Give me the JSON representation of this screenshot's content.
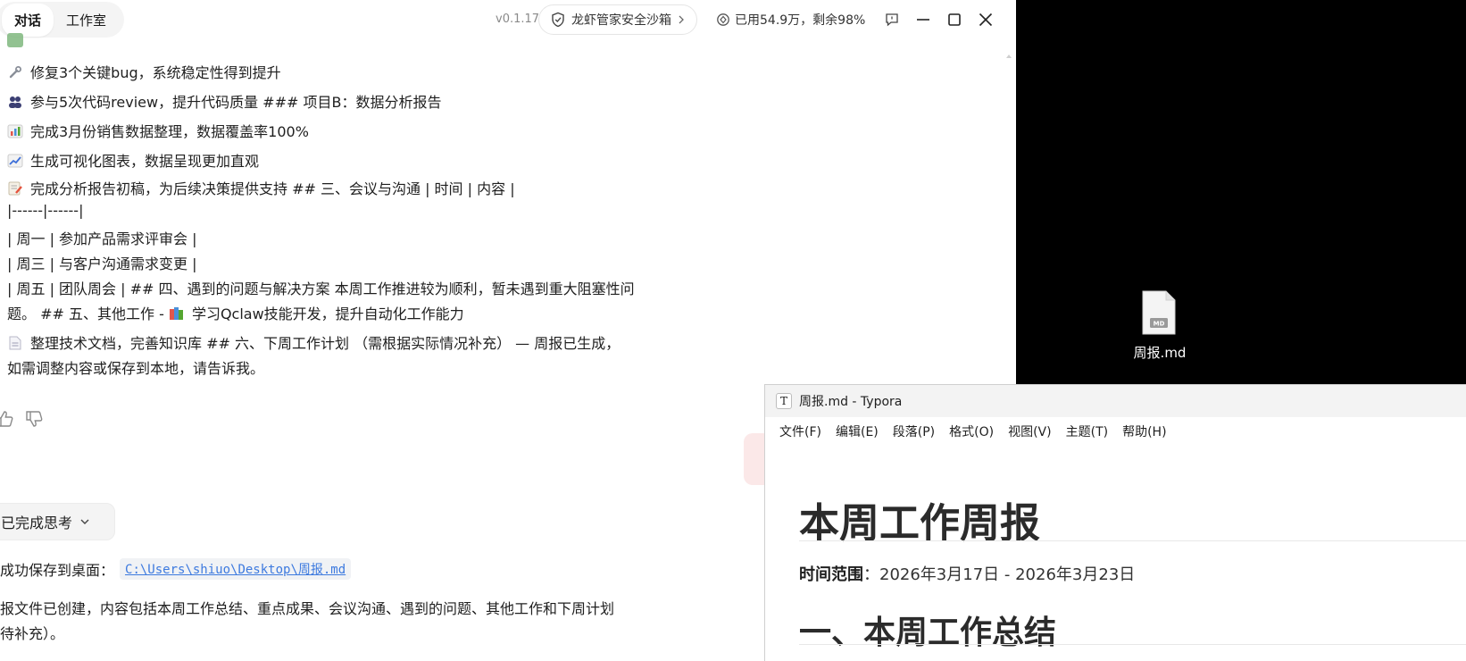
{
  "chat": {
    "tabs": [
      {
        "label": "对话",
        "active": true
      },
      {
        "label": "工作室",
        "active": false
      }
    ],
    "version": "v0.1.17",
    "sandbox_label": "龙虾管家安全沙箱",
    "usage_text": "已用54.9万，剩余98%",
    "message_lines": [
      {
        "icon": "wrench-icon",
        "text": "修复3个关键bug，系统稳定性得到提升"
      },
      {
        "icon": "people-icon",
        "text": "参与5次代码review，提升代码质量 ### 项目B：数据分析报告"
      },
      {
        "icon": "bar-chart-icon",
        "text": "完成3月份销售数据整理，数据覆盖率100%"
      },
      {
        "icon": "trend-up-icon",
        "text": "生成可视化图表，数据呈现更加直观"
      },
      {
        "icon": "memo-icon",
        "text": "完成分析报告初稿，为后续决策提供支持 ## 三、会议与沟通 | 时间 | 内容 |"
      },
      {
        "icon": "",
        "text": "|------|------|"
      },
      {
        "icon": "",
        "text": "| 周一 | 参加产品需求评审会 |"
      },
      {
        "icon": "",
        "text": "| 周三 | 与客户沟通需求变更 |"
      },
      {
        "icon": "",
        "text": "| 周五 | 团队周会 | ## 四、遇到的问题与解决方案 本周工作推进较为顺利，暂未遇到重大阻塞性问"
      },
      {
        "icon": "books-icon",
        "text_before": "题。 ## 五、其他工作 - ",
        "text": "学习Qclaw技能开发，提升自动化工作能力"
      },
      {
        "icon": "document-icon",
        "text": "整理技术文档，完善知识库 ## 六、下周工作计划 （需根据实际情况补充） — 周报已生成，"
      },
      {
        "icon": "",
        "text": "如需调整内容或保存到本地，请告诉我。"
      }
    ],
    "thinking_label": "已完成思考",
    "saved_prefix": "成功保存到桌面：",
    "saved_path": "C:\\Users\\shiuo\\Desktop\\周报.md",
    "summary_lines": [
      "报文件已创建，内容包括本周工作总结、重点成果、会议沟通、遇到的问题、其他工作和下周计划",
      "待补充）。"
    ]
  },
  "desktop": {
    "file_label": "周报.md"
  },
  "typora": {
    "title": "周报.md - Typora",
    "menus": [
      "文件(F)",
      "编辑(E)",
      "段落(P)",
      "格式(O)",
      "视图(V)",
      "主题(T)",
      "帮助(H)"
    ],
    "h1": "本周工作周报",
    "range_label": "时间范围",
    "range_value": "：2026年3月17日 - 2026年3月23日",
    "h2": "一、本周工作总结"
  },
  "colors": {
    "link": "#3d7adf",
    "desktop_bg": "#000000"
  }
}
